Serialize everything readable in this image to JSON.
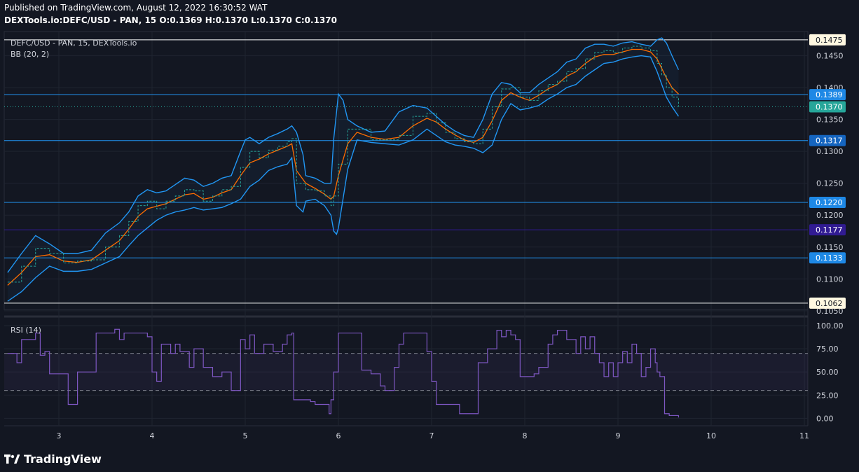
{
  "header": {
    "published": "Published on TradingView.com, August 12, 2022 16:30:52 WAT",
    "symbol_line": "DEXTools.io:DEFC/USD - PAN, 15  O:0.1369 H:0.1370 L:0.1370 C:0.1370"
  },
  "pane_titles": {
    "main": "DEFC/USD - PAN, 15, DEXTools.io",
    "bb": "BB (20, 2)",
    "rsi": "RSI (14)"
  },
  "brand": {
    "name": "TradingView"
  },
  "colors": {
    "background": "#131722",
    "price_line": "#26a69a",
    "bb_band": "#2196f3",
    "bb_basis": "#ff6d00",
    "rsi_line": "#7e57c2",
    "rsi_fill": "#7e57c2",
    "hline_blue": "#2196f3",
    "hline_purple": "#311b92",
    "hline_white": "#ffffff",
    "last_price": "#26a69a"
  },
  "chart_data": {
    "type": "line",
    "x_ticks": [
      "3",
      "4",
      "5",
      "6",
      "7",
      "8",
      "9",
      "10",
      "11"
    ],
    "price_axis": {
      "ylim": [
        0.1052,
        0.1488
      ],
      "ticks": [
        "0.1050",
        "0.1100",
        "0.1150",
        "0.1200",
        "0.1250",
        "0.1300",
        "0.1350",
        "0.1400",
        "0.1450"
      ]
    },
    "horizontal_levels": [
      {
        "value": 0.1475,
        "label": "0.1475",
        "kind": "white"
      },
      {
        "value": 0.1389,
        "label": "0.1389",
        "kind": "blue"
      },
      {
        "value": 0.1317,
        "label": "0.1317",
        "kind": "blue"
      },
      {
        "value": 0.122,
        "label": "0.1220",
        "kind": "blue"
      },
      {
        "value": 0.1177,
        "label": "0.1177",
        "kind": "purple"
      },
      {
        "value": 0.1133,
        "label": "0.1133",
        "kind": "blue"
      },
      {
        "value": 0.1062,
        "label": "0.1062",
        "kind": "white"
      }
    ],
    "last_price": {
      "value": 0.137,
      "label": "0.1370"
    },
    "price_series": {
      "name": "DEFC/USD",
      "x": [
        2.45,
        2.6,
        2.75,
        2.9,
        3.05,
        3.2,
        3.35,
        3.5,
        3.65,
        3.75,
        3.85,
        3.95,
        4.05,
        4.15,
        4.25,
        4.35,
        4.45,
        4.55,
        4.65,
        4.75,
        4.85,
        4.95,
        5.05,
        5.15,
        5.25,
        5.35,
        5.45,
        5.5,
        5.55,
        5.65,
        5.75,
        5.85,
        5.92,
        5.95,
        6.0,
        6.1,
        6.2,
        6.35,
        6.5,
        6.65,
        6.8,
        6.95,
        7.05,
        7.15,
        7.25,
        7.35,
        7.45,
        7.55,
        7.65,
        7.75,
        7.85,
        7.95,
        8.05,
        8.15,
        8.25,
        8.35,
        8.45,
        8.55,
        8.65,
        8.75,
        8.85,
        8.95,
        9.05,
        9.15,
        9.25,
        9.35,
        9.42,
        9.47,
        9.52,
        9.58,
        9.65
      ],
      "y": [
        0.1095,
        0.112,
        0.1148,
        0.114,
        0.1125,
        0.1128,
        0.113,
        0.115,
        0.1168,
        0.119,
        0.1215,
        0.1222,
        0.121,
        0.1222,
        0.123,
        0.124,
        0.1238,
        0.1222,
        0.123,
        0.124,
        0.1245,
        0.1275,
        0.13,
        0.129,
        0.1302,
        0.1308,
        0.1315,
        0.132,
        0.125,
        0.124,
        0.1238,
        0.123,
        0.1215,
        0.123,
        0.128,
        0.1335,
        0.1335,
        0.1318,
        0.1318,
        0.1325,
        0.1355,
        0.136,
        0.1345,
        0.133,
        0.132,
        0.1315,
        0.1312,
        0.1335,
        0.137,
        0.1398,
        0.14,
        0.1385,
        0.138,
        0.1395,
        0.1405,
        0.141,
        0.1425,
        0.143,
        0.1445,
        0.1455,
        0.1458,
        0.1455,
        0.1462,
        0.1465,
        0.1462,
        0.1458,
        0.1438,
        0.142,
        0.14,
        0.1385,
        0.137
      ]
    },
    "bb_basis": {
      "name": "BB basis",
      "x": [
        2.45,
        2.6,
        2.75,
        2.9,
        3.05,
        3.2,
        3.35,
        3.5,
        3.65,
        3.75,
        3.85,
        3.95,
        4.05,
        4.15,
        4.25,
        4.35,
        4.45,
        4.55,
        4.65,
        4.75,
        4.85,
        4.95,
        5.05,
        5.15,
        5.25,
        5.35,
        5.45,
        5.5,
        5.55,
        5.65,
        5.75,
        5.85,
        5.92,
        5.95,
        6.0,
        6.1,
        6.2,
        6.35,
        6.5,
        6.65,
        6.8,
        6.95,
        7.05,
        7.15,
        7.25,
        7.35,
        7.45,
        7.55,
        7.65,
        7.75,
        7.85,
        7.95,
        8.05,
        8.15,
        8.25,
        8.35,
        8.45,
        8.55,
        8.65,
        8.75,
        8.85,
        8.95,
        9.05,
        9.15,
        9.25,
        9.35,
        9.42,
        9.47,
        9.52,
        9.58,
        9.65
      ],
      "y": [
        0.109,
        0.111,
        0.1135,
        0.1138,
        0.1128,
        0.1126,
        0.113,
        0.1145,
        0.116,
        0.1178,
        0.1198,
        0.121,
        0.1214,
        0.1218,
        0.1225,
        0.1232,
        0.1234,
        0.1225,
        0.1228,
        0.1235,
        0.124,
        0.1262,
        0.1282,
        0.1288,
        0.1296,
        0.1302,
        0.1308,
        0.1312,
        0.127,
        0.125,
        0.1242,
        0.1233,
        0.1225,
        0.123,
        0.1262,
        0.1312,
        0.133,
        0.1322,
        0.1319,
        0.1322,
        0.134,
        0.1352,
        0.1346,
        0.1335,
        0.1326,
        0.1318,
        0.1314,
        0.1322,
        0.1348,
        0.138,
        0.1392,
        0.1385,
        0.138,
        0.1388,
        0.1398,
        0.1405,
        0.1418,
        0.1425,
        0.1438,
        0.1448,
        0.1452,
        0.1452,
        0.1456,
        0.146,
        0.146,
        0.1456,
        0.1445,
        0.143,
        0.1415,
        0.14,
        0.139
      ]
    },
    "bb_upper": {
      "name": "BB upper",
      "x": [
        2.45,
        2.6,
        2.75,
        2.9,
        3.05,
        3.2,
        3.35,
        3.5,
        3.65,
        3.75,
        3.85,
        3.95,
        4.05,
        4.15,
        4.25,
        4.35,
        4.45,
        4.55,
        4.65,
        4.75,
        4.85,
        4.95,
        5.0,
        5.05,
        5.15,
        5.25,
        5.35,
        5.45,
        5.5,
        5.55,
        5.62,
        5.65,
        5.75,
        5.85,
        5.92,
        5.95,
        6.0,
        6.05,
        6.1,
        6.2,
        6.35,
        6.5,
        6.65,
        6.8,
        6.95,
        7.05,
        7.15,
        7.25,
        7.35,
        7.45,
        7.55,
        7.65,
        7.75,
        7.85,
        7.95,
        8.05,
        8.15,
        8.25,
        8.35,
        8.45,
        8.55,
        8.65,
        8.75,
        8.85,
        8.95,
        9.05,
        9.15,
        9.25,
        9.35,
        9.42,
        9.47,
        9.52,
        9.58,
        9.65
      ],
      "y": [
        0.111,
        0.114,
        0.1168,
        0.1155,
        0.114,
        0.114,
        0.1145,
        0.1172,
        0.1188,
        0.1205,
        0.123,
        0.124,
        0.1235,
        0.1238,
        0.1248,
        0.1258,
        0.1255,
        0.1245,
        0.125,
        0.1258,
        0.1262,
        0.13,
        0.1318,
        0.1322,
        0.1312,
        0.1322,
        0.1328,
        0.1335,
        0.134,
        0.133,
        0.1295,
        0.1262,
        0.1258,
        0.125,
        0.125,
        0.132,
        0.139,
        0.138,
        0.135,
        0.134,
        0.133,
        0.1332,
        0.1362,
        0.1372,
        0.1368,
        0.1355,
        0.1342,
        0.1332,
        0.1325,
        0.1322,
        0.135,
        0.139,
        0.1408,
        0.1405,
        0.1392,
        0.1392,
        0.1405,
        0.1415,
        0.1425,
        0.144,
        0.1445,
        0.1462,
        0.1468,
        0.1468,
        0.1465,
        0.147,
        0.1472,
        0.1468,
        0.1465,
        0.1475,
        0.1478,
        0.147,
        0.145,
        0.1428
      ]
    },
    "bb_lower": {
      "name": "BB lower",
      "x": [
        2.45,
        2.6,
        2.75,
        2.9,
        3.05,
        3.2,
        3.35,
        3.5,
        3.65,
        3.75,
        3.85,
        3.95,
        4.05,
        4.15,
        4.25,
        4.35,
        4.45,
        4.55,
        4.65,
        4.75,
        4.85,
        4.95,
        5.05,
        5.15,
        5.25,
        5.35,
        5.45,
        5.5,
        5.55,
        5.62,
        5.65,
        5.75,
        5.85,
        5.92,
        5.95,
        5.98,
        6.0,
        6.1,
        6.2,
        6.35,
        6.5,
        6.65,
        6.8,
        6.95,
        7.05,
        7.15,
        7.25,
        7.35,
        7.45,
        7.55,
        7.65,
        7.75,
        7.85,
        7.95,
        8.05,
        8.15,
        8.25,
        8.35,
        8.45,
        8.55,
        8.65,
        8.75,
        8.85,
        8.95,
        9.05,
        9.15,
        9.25,
        9.35,
        9.42,
        9.47,
        9.52,
        9.58,
        9.65
      ],
      "y": [
        0.1065,
        0.108,
        0.1102,
        0.112,
        0.1112,
        0.1112,
        0.1115,
        0.1125,
        0.1135,
        0.1152,
        0.1168,
        0.118,
        0.1192,
        0.12,
        0.1205,
        0.1208,
        0.1212,
        0.1208,
        0.121,
        0.1212,
        0.1218,
        0.1225,
        0.1245,
        0.1255,
        0.127,
        0.1276,
        0.128,
        0.129,
        0.1215,
        0.1205,
        0.1222,
        0.1225,
        0.1215,
        0.12,
        0.1175,
        0.117,
        0.118,
        0.1272,
        0.1318,
        0.1314,
        0.1312,
        0.131,
        0.1318,
        0.1335,
        0.1325,
        0.1315,
        0.131,
        0.1308,
        0.1305,
        0.1298,
        0.131,
        0.135,
        0.1375,
        0.1365,
        0.1368,
        0.1372,
        0.1382,
        0.139,
        0.14,
        0.1405,
        0.1418,
        0.1428,
        0.1438,
        0.144,
        0.1445,
        0.1448,
        0.145,
        0.1448,
        0.1425,
        0.1405,
        0.1385,
        0.137,
        0.1355
      ]
    },
    "rsi": {
      "name": "RSI",
      "ylim": [
        -8,
        106
      ],
      "ticks": [
        "100.00",
        "75.00",
        "50.00",
        "25.00",
        "0.00"
      ],
      "bands": [
        70,
        30
      ],
      "x": [
        2.45,
        2.55,
        2.6,
        2.75,
        2.8,
        2.85,
        2.9,
        3.05,
        3.1,
        3.2,
        3.35,
        3.4,
        3.5,
        3.6,
        3.65,
        3.7,
        3.75,
        3.85,
        3.95,
        4.0,
        4.05,
        4.1,
        4.2,
        4.25,
        4.3,
        4.4,
        4.45,
        4.55,
        4.65,
        4.75,
        4.85,
        4.95,
        5.0,
        5.05,
        5.1,
        5.2,
        5.3,
        5.4,
        5.45,
        5.5,
        5.52,
        5.7,
        5.75,
        5.85,
        5.9,
        5.92,
        5.95,
        6.0,
        6.1,
        6.2,
        6.25,
        6.35,
        6.45,
        6.5,
        6.6,
        6.65,
        6.7,
        6.8,
        6.9,
        6.95,
        7.0,
        7.05,
        7.2,
        7.3,
        7.4,
        7.45,
        7.5,
        7.55,
        7.6,
        7.7,
        7.75,
        7.8,
        7.85,
        7.9,
        7.95,
        8.05,
        8.1,
        8.15,
        8.2,
        8.25,
        8.3,
        8.35,
        8.45,
        8.55,
        8.6,
        8.65,
        8.7,
        8.75,
        8.8,
        8.85,
        8.9,
        8.95,
        9.0,
        9.05,
        9.1,
        9.15,
        9.2,
        9.25,
        9.3,
        9.35,
        9.4,
        9.42,
        9.45,
        9.5,
        9.55,
        9.65
      ],
      "y": [
        70,
        60,
        85,
        92,
        68,
        72,
        48,
        48,
        15,
        50,
        50,
        92,
        92,
        96,
        85,
        92,
        92,
        92,
        88,
        50,
        40,
        80,
        70,
        80,
        72,
        55,
        75,
        55,
        45,
        50,
        30,
        85,
        75,
        90,
        70,
        80,
        72,
        80,
        90,
        92,
        20,
        18,
        15,
        15,
        5,
        20,
        50,
        92,
        92,
        92,
        52,
        48,
        35,
        30,
        55,
        80,
        92,
        92,
        92,
        72,
        40,
        15,
        15,
        5,
        5,
        5,
        60,
        60,
        75,
        95,
        88,
        95,
        90,
        85,
        45,
        45,
        48,
        55,
        55,
        80,
        90,
        95,
        85,
        70,
        88,
        75,
        88,
        70,
        60,
        45,
        60,
        45,
        60,
        72,
        60,
        80,
        70,
        45,
        55,
        75,
        60,
        50,
        45,
        5,
        3,
        1
      ]
    }
  }
}
